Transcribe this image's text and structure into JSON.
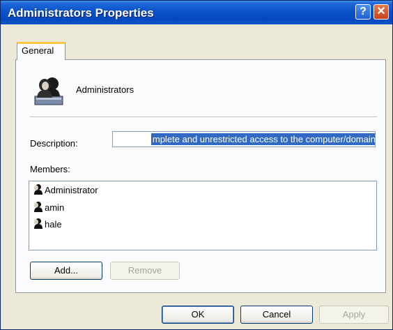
{
  "window": {
    "title": "Administrators Properties",
    "help_label": "?",
    "close_label": "✕"
  },
  "tabs": [
    {
      "label": "General",
      "selected": true
    }
  ],
  "group": {
    "name": "Administrators",
    "icon": "user-group-icon"
  },
  "description": {
    "label": "Description:",
    "value": "mplete and unrestricted access to the computer/domain"
  },
  "members": {
    "label": "Members:",
    "items": [
      {
        "name": "Administrator",
        "icon": "user-icon"
      },
      {
        "name": "amin",
        "icon": "user-icon"
      },
      {
        "name": "hale",
        "icon": "user-icon"
      }
    ]
  },
  "buttons": {
    "add": "Add...",
    "remove": "Remove",
    "ok": "OK",
    "cancel": "Cancel",
    "apply": "Apply"
  },
  "colors": {
    "titlebar": "#0a52c9",
    "selection": "#316ac5",
    "dialog_bg": "#ece9d8"
  }
}
